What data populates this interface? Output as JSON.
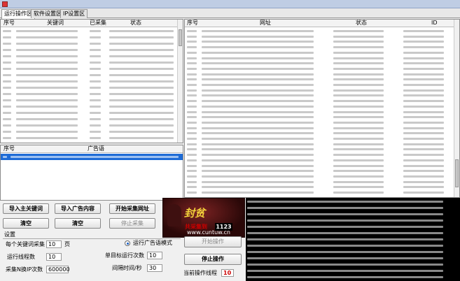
{
  "tabs": [
    "运行操作区",
    "软件设置区",
    "IP设置区"
  ],
  "keyword_table": {
    "headers": [
      "序号",
      "关键词",
      "已采集",
      "状态"
    ],
    "row_count": 18
  },
  "result_table": {
    "headers": [
      "序号",
      "网址",
      "状态",
      "ID"
    ],
    "row_count": 31
  },
  "ad_table": {
    "headers": [
      "序号",
      "广告语"
    ],
    "row_count": 1
  },
  "buttons": {
    "import_keywords": "导入主关键词",
    "import_ads": "导入广告内容",
    "start_collect": "开始采集网址",
    "clear_left": "清空",
    "clear_right": "清空",
    "stop_collect": "停止采集",
    "start_operation": "开始操作",
    "stop_operation": "停止操作"
  },
  "settings": {
    "section_label": "设置",
    "per_keyword_label": "每个关键词采集",
    "per_keyword_value": "10",
    "per_keyword_unit": "页",
    "threads_label": "运行线程数",
    "threads_value": "10",
    "ip_label": "采集N换IP次数",
    "ip_value": "600000",
    "mode_label": "运行广告语模式",
    "single_runs_label": "单目标运行次数",
    "single_runs_value": "10",
    "interval_label": "间隔时间/秒",
    "interval_value": "30",
    "collected_label": "共采集到",
    "collected_value": "1123",
    "current_threads_label": "当前操作线程",
    "current_threads_value": "10"
  },
  "logo": {
    "title": "封贫",
    "url": "www.cuntuw.cn"
  },
  "log": {
    "line_count": 13
  },
  "colors": {
    "selection": "#1e6bd6",
    "log_bg": "#000000",
    "accent_red": "#cc0000"
  }
}
